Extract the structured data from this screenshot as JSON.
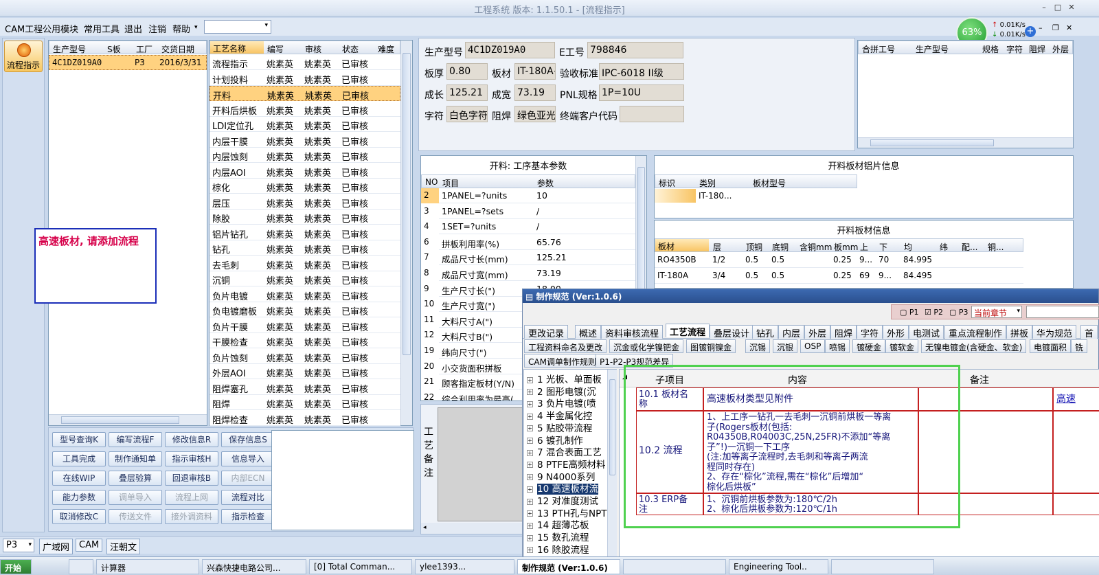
{
  "window": {
    "title": "工程系统   版本: 1.1.50.1 - [流程指示]"
  },
  "menu": {
    "items": [
      "CAM工程",
      "公用模块",
      "常用工具",
      "退出",
      "注销",
      "帮助"
    ]
  },
  "perf": {
    "percent": "63%",
    "up": "0.01K/s",
    "down": "0.01K/s"
  },
  "sidebar": {
    "label": "流程指示"
  },
  "orders": {
    "headers": [
      "生产型号",
      "S板",
      "工厂",
      "交货日期"
    ],
    "rows": [
      [
        "4C1DZ019A0",
        "",
        "P3",
        "2016/3/31"
      ]
    ]
  },
  "notice": {
    "text": "高速板材, 请添加流程"
  },
  "process": {
    "headers": [
      "工艺名称",
      "编写",
      "审核",
      "状态",
      "难度"
    ],
    "rows": [
      [
        "流程指示",
        "姚素英",
        "姚素英",
        "已审核"
      ],
      [
        "计划投料",
        "姚素英",
        "姚素英",
        "已审核"
      ],
      [
        "开料",
        "姚素英",
        "姚素英",
        "已审核"
      ],
      [
        "开料后烘板",
        "姚素英",
        "姚素英",
        "已审核"
      ],
      [
        "LDI定位孔",
        "姚素英",
        "姚素英",
        "已审核"
      ],
      [
        "内层干膜",
        "姚素英",
        "姚素英",
        "已审核"
      ],
      [
        "内层蚀刻",
        "姚素英",
        "姚素英",
        "已审核"
      ],
      [
        "内层AOI",
        "姚素英",
        "姚素英",
        "已审核"
      ],
      [
        "棕化",
        "姚素英",
        "姚素英",
        "已审核"
      ],
      [
        "层压",
        "姚素英",
        "姚素英",
        "已审核"
      ],
      [
        "除胶",
        "姚素英",
        "姚素英",
        "已审核"
      ],
      [
        "铝片钻孔",
        "姚素英",
        "姚素英",
        "已审核"
      ],
      [
        "钻孔",
        "姚素英",
        "姚素英",
        "已审核"
      ],
      [
        "去毛刺",
        "姚素英",
        "姚素英",
        "已审核"
      ],
      [
        "沉铜",
        "姚素英",
        "姚素英",
        "已审核"
      ],
      [
        "负片电镀",
        "姚素英",
        "姚素英",
        "已审核"
      ],
      [
        "负电镀磨板",
        "姚素英",
        "姚素英",
        "已审核"
      ],
      [
        "负片干膜",
        "姚素英",
        "姚素英",
        "已审核"
      ],
      [
        "干膜检查",
        "姚素英",
        "姚素英",
        "已审核"
      ],
      [
        "负片蚀刻",
        "姚素英",
        "姚素英",
        "已审核"
      ],
      [
        "外层AOI",
        "姚素英",
        "姚素英",
        "已审核"
      ],
      [
        "阻焊塞孔",
        "姚素英",
        "姚素英",
        "已审核"
      ],
      [
        "阻焊",
        "姚素英",
        "姚素英",
        "已审核"
      ],
      [
        "阻焊检查",
        "姚素英",
        "姚素英",
        "已审核"
      ]
    ]
  },
  "buttons": [
    [
      "型号查询K",
      "编写流程F",
      "修改信息R",
      "保存信息S"
    ],
    [
      "工具完成",
      "制作通知单",
      "指示审核H",
      "信息导入"
    ],
    [
      "在线WIP",
      "叠层验算",
      "回退审核B",
      "内部ECN"
    ],
    [
      "能力参数",
      "调单导入",
      "流程上网",
      "流程对比"
    ],
    [
      "取消修改C",
      "传送文件",
      "接外调资料",
      "指示检查"
    ]
  ],
  "info": {
    "labels": [
      "生产型号",
      "E工号",
      "板厚",
      "板材",
      "验收标准",
      "成长",
      "成宽",
      "PNL规格",
      "字符",
      "阻焊",
      "终端客户代码"
    ],
    "model": "4C1DZ019A0",
    "eno": "798846",
    "thickness": "0.80",
    "material": "IT-180A+",
    "standard": "IPC-6018 II级",
    "length": "125.21",
    "width": "73.19",
    "pnl": "1P=10U",
    "char": "白色字符",
    "mask": "绿色亚光",
    "customer": ""
  },
  "merge": {
    "headers": [
      "合拼工号",
      "生产型号",
      "规格",
      "字符",
      "阻焊",
      "外层"
    ]
  },
  "params": {
    "title": "开料: 工序基本参数",
    "headers": [
      "NO",
      "项目",
      "参数"
    ],
    "rows": [
      [
        "2",
        "1PANEL=?units",
        "10"
      ],
      [
        "3",
        "1PANEL=?sets",
        "/"
      ],
      [
        "4",
        "1SET=?units",
        "/"
      ],
      [
        "6",
        "拼板利用率(%)",
        "65.76"
      ],
      [
        "7",
        "成品尺寸长(mm)",
        "125.21"
      ],
      [
        "8",
        "成品尺寸宽(mm)",
        "73.19"
      ],
      [
        "9",
        "生产尺寸长(\")",
        "18.00"
      ],
      [
        "10",
        "生产尺寸宽(\")",
        ""
      ],
      [
        "11",
        "大料尺寸A(\")",
        ""
      ],
      [
        "12",
        "大料尺寸B(\")",
        ""
      ],
      [
        "19",
        "纬向尺寸(\")",
        ""
      ],
      [
        "20",
        "小交货面积拼板",
        ""
      ],
      [
        "21",
        "顾客指定板材(Y/N)",
        ""
      ],
      [
        "22",
        "综合利用率为最高(",
        ""
      ]
    ]
  },
  "sheet": {
    "title": "开料板材铝片信息",
    "headers": [
      "标识",
      "类别",
      "板材型号"
    ],
    "rows": [
      [
        "",
        "IT-180...",
        ""
      ]
    ]
  },
  "board": {
    "title": "开料板材信息",
    "headers": [
      "板材",
      "层",
      "顶铜",
      "底铜",
      "含铜mm",
      "板mm",
      "上",
      "下",
      "均",
      "纬",
      "配...",
      "铜..."
    ],
    "rows": [
      [
        "RO4350B",
        "1/2",
        "0.5",
        "0.5",
        "",
        "0.25",
        "9...",
        "70",
        "84.995",
        "",
        "",
        ""
      ],
      [
        "IT-180A",
        "3/4",
        "0.5",
        "0.5",
        "",
        "0.25",
        "69",
        "9...",
        "84.495",
        "",
        "",
        ""
      ]
    ]
  },
  "remark": {
    "label": "工艺备注"
  },
  "dialog": {
    "title": "制作规范 (Ver:1.0.6)",
    "checks": [
      "P1",
      "P2",
      "P3"
    ],
    "chapter": "当前章节",
    "tabs1": [
      "更改记录",
      "概述",
      "资料审核流程",
      "工艺流程",
      "叠层设计",
      "钻孔",
      "内层",
      "外层",
      "阻焊",
      "字符",
      "外形",
      "电测试",
      "重点流程制作",
      "拼板",
      "华为规范",
      "首"
    ],
    "tabs2": [
      "工程资料命名及更改",
      "沉金或化学镍钯金",
      "图镀铜镍金",
      "沉锡",
      "沉银",
      "OSP",
      "喷锡",
      "镀硬金",
      "镀软金",
      "无镍电镀金(含硬金、软金)",
      "电镀面积",
      "铣"
    ],
    "tabs3": [
      "CAM调单制作规则",
      "P1-P2-P3规范差异"
    ],
    "tree": [
      "1 光板、单面板",
      "2 图形电镀(沉",
      "3 负片电镀(喷",
      "4 半金属化控",
      "5 贴胶带流程",
      "6 镀孔制作",
      "7 混合表面工艺",
      "8 PTFE高频材料",
      "9 N4000系列",
      "10 高速板材流",
      "12 对准度测试",
      "13 PTH孔与NPT",
      "14 超薄芯板",
      "15 数孔流程",
      "16 除胶流程"
    ],
    "table_headers": [
      "子项目",
      "内容",
      "备注"
    ],
    "r1": {
      "item": [
        "10.1 板材名",
        "称"
      ],
      "content": "高速板材类型见附件",
      "link": "高速"
    },
    "r2": {
      "item": "10.2 流程",
      "content": [
        "1、上工序一钻孔一去毛刺一沉铜前烘板一等离",
        "子(Rogers板材(包括:",
        "R04350B,R04003C,25N,25FR)不添加“等离",
        "子”!)一沉铜一下工序",
        "(注:加等离子流程时,去毛刺和等离子两流",
        "程同时存在)",
        "2、存在“棕化”流程,需在“棕化”后增加“",
        "棕化后烘板”"
      ]
    },
    "r3": {
      "item": [
        "10.3 ERP备",
        "注"
      ],
      "content": [
        "1、沉铜前烘板参数为:180℃/2h",
        "2、棕化后烘板参数为:120℃/1h"
      ]
    }
  },
  "status": {
    "site": "P3",
    "items": [
      "广域网",
      "CAM",
      "汪朝文"
    ]
  },
  "taskbar": {
    "items": [
      "开始",
      "",
      "计算器",
      "兴森快捷电路公司...",
      "[0] Total Comman...",
      "ylee1393...",
      "制作规范 (Ver:1.0.6)",
      "",
      "Engineering Tool..",
      ""
    ]
  }
}
